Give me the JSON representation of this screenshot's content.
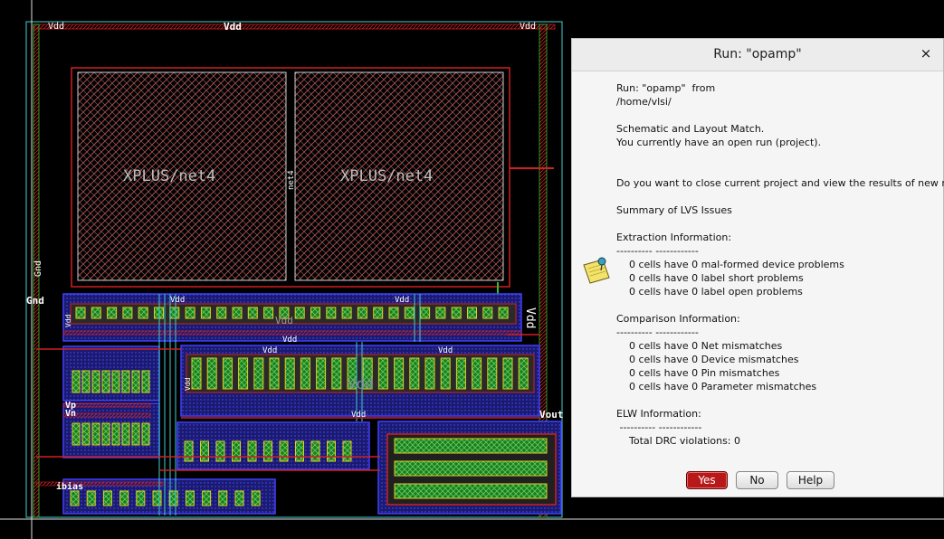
{
  "layout": {
    "labels": {
      "vdd_top_left": "Vdd",
      "vdd_top_center": "Vdd",
      "vdd_top_right": "Vdd",
      "gnd_vertical": "Gnd",
      "gnd_left": "Gnd",
      "net_a": "XPLUS/net4",
      "net_b": "XPLUS/net4",
      "net4_vertical": "net4",
      "vdd_row1_a": "Vdd",
      "vdd_row1_b": "Vdd",
      "vdd_row1_center": "Vdd",
      "vdd_row1_side": "Vdd",
      "vdd_right_vertical": "Vdd",
      "vdd_row2_top": "Vdd",
      "vdd_row2_a": "Vdd",
      "vdd_row2_b": "Vdd",
      "vdd_row2_center": "Vdd",
      "vdd_row2_side": "Vdd",
      "vdd_mid": "Vdd",
      "vp": "Vp",
      "vn": "Vn",
      "vout": "Vout",
      "ibias": "ibias"
    }
  },
  "dialog": {
    "title": "Run: \"opamp\"",
    "close_glyph": "×",
    "lines": [
      "Run: \"opamp\"  from",
      "/home/vlsi/",
      "",
      "Schematic and Layout Match.",
      "You currently have an open run (project).",
      "",
      "",
      "Do you want to close current project and view the results of new run?",
      "",
      "Summary of LVS Issues",
      "",
      "Extraction Information:",
      "---------- ------------",
      "    0 cells have 0 mal-formed device problems",
      "    0 cells have 0 label short problems",
      "    0 cells have 0 label open problems",
      "",
      "Comparison Information:",
      "---------- ------------",
      "    0 cells have 0 Net mismatches",
      "    0 cells have 0 Device mismatches",
      "    0 cells have 0 Pin mismatches",
      "    0 cells have 0 Parameter mismatches",
      "",
      "ELW Information:",
      " ---------- ------------",
      "    Total DRC violations: 0"
    ],
    "buttons": {
      "yes": "Yes",
      "no": "No",
      "help": "Help"
    },
    "icon": "note-pin-icon"
  },
  "colors": {
    "metal_red": "#d02020",
    "well_blue": "#3030d0",
    "cyan": "#40d0d0",
    "green": "#30c030",
    "yellow": "#e0d020",
    "dialog_bg": "#f5f5f5",
    "yes_button": "#b81818"
  }
}
